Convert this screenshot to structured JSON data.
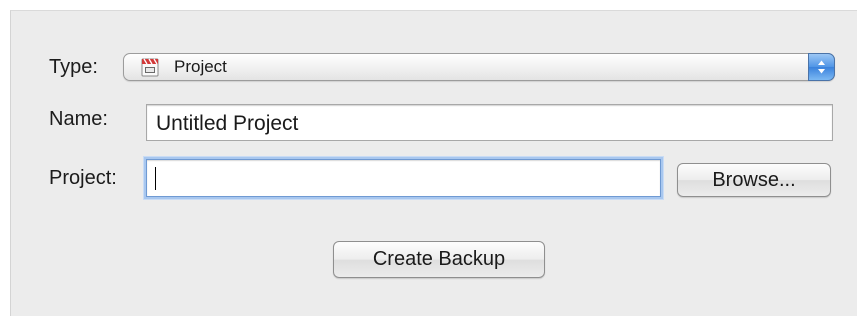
{
  "form": {
    "type_label": "Type:",
    "type_selected": "Project",
    "type_icon": "movie-clapperboard-icon",
    "name_label": "Name:",
    "name_value": "Untitled Project",
    "project_label": "Project:",
    "project_value": "",
    "browse_label": "Browse...",
    "create_label": "Create Backup"
  },
  "colors": {
    "panel_bg": "#ececec",
    "focus_ring": "#a8c7ef",
    "popup_arrow_blue": "#4f95e6"
  }
}
